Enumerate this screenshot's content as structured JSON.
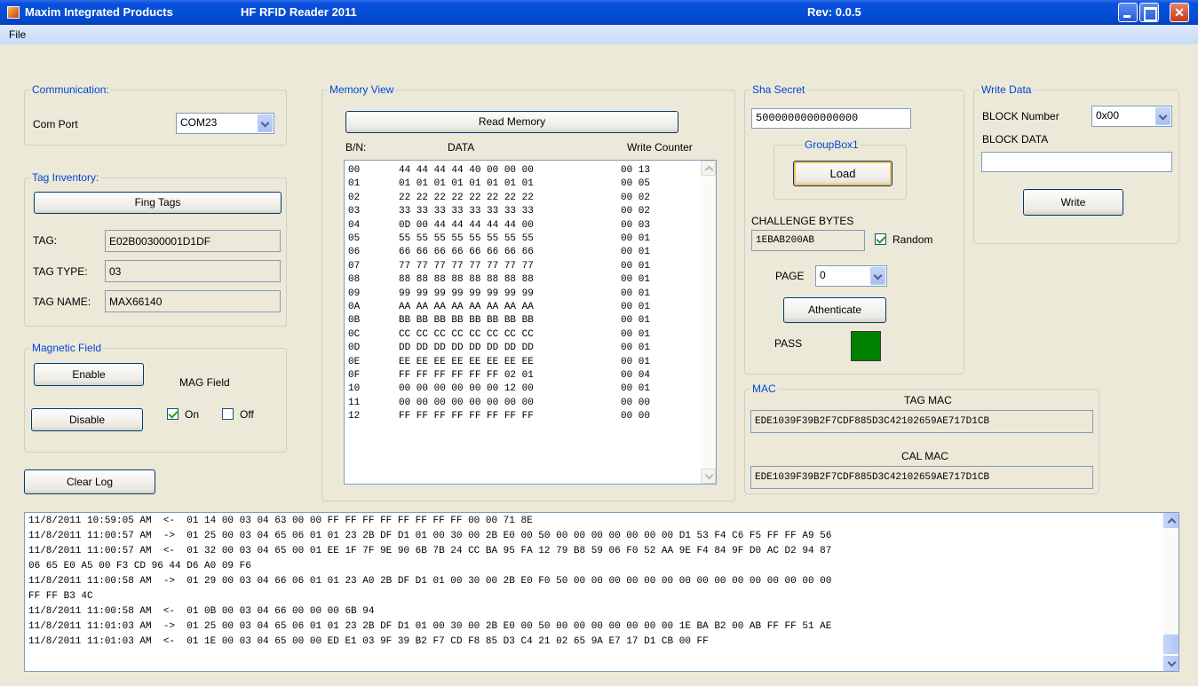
{
  "window": {
    "company": "Maxim Integrated Products",
    "app_title": "HF RFID Reader 2011",
    "rev": "Rev: 0.0.5"
  },
  "menu": {
    "file": "File"
  },
  "communication": {
    "legend": "Communication:",
    "com_port_label": "Com Port",
    "com_port_value": "COM23"
  },
  "tag_inventory": {
    "legend": "Tag Inventory:",
    "find_button": "Fing Tags",
    "tag_label": "TAG:",
    "tag_value": "E02B00300001D1DF",
    "tag_type_label": "TAG TYPE:",
    "tag_type_value": "03",
    "tag_name_label": "TAG NAME:",
    "tag_name_value": "MAX66140"
  },
  "magnetic_field": {
    "legend": "Magnetic Field",
    "enable_button": "Enable",
    "disable_button": "Disable",
    "mag_field_label": "MAG Field",
    "on_label": "On",
    "off_label": "Off",
    "on_checked": true,
    "off_checked": false
  },
  "clear_log_button": "Clear Log",
  "memory_view": {
    "legend": "Memory View",
    "read_button": "Read Memory",
    "col_bn": "B/N:",
    "col_data": "DATA",
    "col_counter": "Write Counter",
    "rows": [
      {
        "bn": "00",
        "data": "44 44 44 44 40 00 00 00",
        "wc": "00 13"
      },
      {
        "bn": "01",
        "data": "01 01 01 01 01 01 01 01",
        "wc": "00 05"
      },
      {
        "bn": "02",
        "data": "22 22 22 22 22 22 22 22",
        "wc": "00 02"
      },
      {
        "bn": "03",
        "data": "33 33 33 33 33 33 33 33",
        "wc": "00 02"
      },
      {
        "bn": "04",
        "data": "0D 00 44 44 44 44 44 00",
        "wc": "00 03"
      },
      {
        "bn": "05",
        "data": "55 55 55 55 55 55 55 55",
        "wc": "00 01"
      },
      {
        "bn": "06",
        "data": "66 66 66 66 66 66 66 66",
        "wc": "00 01"
      },
      {
        "bn": "07",
        "data": "77 77 77 77 77 77 77 77",
        "wc": "00 01"
      },
      {
        "bn": "08",
        "data": "88 88 88 88 88 88 88 88",
        "wc": "00 01"
      },
      {
        "bn": "09",
        "data": "99 99 99 99 99 99 99 99",
        "wc": "00 01"
      },
      {
        "bn": "0A",
        "data": "AA AA AA AA AA AA AA AA",
        "wc": "00 01"
      },
      {
        "bn": "0B",
        "data": "BB BB BB BB BB BB BB BB",
        "wc": "00 01"
      },
      {
        "bn": "0C",
        "data": "CC CC CC CC CC CC CC CC",
        "wc": "00 01"
      },
      {
        "bn": "0D",
        "data": "DD DD DD DD DD DD DD DD",
        "wc": "00 01"
      },
      {
        "bn": "0E",
        "data": "EE EE EE EE EE EE EE EE",
        "wc": "00 01"
      },
      {
        "bn": "0F",
        "data": "FF FF FF FF FF FF 02 01",
        "wc": "00 04"
      },
      {
        "bn": "10",
        "data": "00 00 00 00 00 00 12 00",
        "wc": "00 01"
      },
      {
        "bn": "11",
        "data": "00 00 00 00 00 00 00 00",
        "wc": "00 00"
      },
      {
        "bn": "12",
        "data": "FF FF FF FF FF FF FF FF",
        "wc": "00 00"
      }
    ]
  },
  "sha_secret": {
    "legend": "Sha Secret",
    "secret_value": "5000000000000000",
    "groupbox_legend": "GroupBox1",
    "load_button": "Load",
    "challenge_label": "CHALLENGE BYTES",
    "challenge_value": "1EBAB200AB",
    "random_label": "Random",
    "random_checked": true,
    "page_label": "PAGE",
    "page_value": "0",
    "authenticate_button": "Athenticate",
    "pass_label": "PASS",
    "pass_color": "#008000"
  },
  "write_data": {
    "legend": "Write Data",
    "block_number_label": "BLOCK Number",
    "block_number_value": "0x00",
    "block_data_label": "BLOCK DATA",
    "block_data_value": "",
    "write_button": "Write"
  },
  "mac": {
    "legend": "MAC",
    "tag_mac_label": "TAG MAC",
    "tag_mac_value": "EDE1039F39B2F7CDF885D3C42102659AE717D1CB",
    "cal_mac_label": "CAL MAC",
    "cal_mac_value": "EDE1039F39B2F7CDF885D3C42102659AE717D1CB"
  },
  "log": {
    "lines": [
      "11/8/2011 10:59:05 AM  <-  01 14 00 03 04 63 00 00 FF FF FF FF FF FF FF FF 00 00 71 8E",
      "11/8/2011 11:00:57 AM  ->  01 25 00 03 04 65 06 01 01 23 2B DF D1 01 00 30 00 2B E0 00 50 00 00 00 00 00 00 00 D1 53 F4 C6 F5 FF FF A9 56",
      "11/8/2011 11:00:57 AM  <-  01 32 00 03 04 65 00 01 EE 1F 7F 9E 90 6B 7B 24 CC BA 95 FA 12 79 B8 59 06 F0 52 AA 9E F4 84 9F D0 AC D2 94 87",
      "06 65 E0 A5 00 F3 CD 96 44 D6 A0 09 F6",
      "11/8/2011 11:00:58 AM  ->  01 29 00 03 04 66 06 01 01 23 A0 2B DF D1 01 00 30 00 2B E0 F0 50 00 00 00 00 00 00 00 00 00 00 00 00 00 00 00",
      "FF FF B3 4C",
      "11/8/2011 11:00:58 AM  <-  01 0B 00 03 04 66 00 00 00 6B 94",
      "11/8/2011 11:01:03 AM  ->  01 25 00 03 04 65 06 01 01 23 2B DF D1 01 00 30 00 2B E0 00 50 00 00 00 00 00 00 00 1E BA B2 00 AB FF FF 51 AE",
      "11/8/2011 11:01:03 AM  <-  01 1E 00 03 04 65 00 00 ED E1 03 9F 39 B2 F7 CD F8 85 D3 C4 21 02 65 9A E7 17 D1 CB 00 FF"
    ]
  }
}
